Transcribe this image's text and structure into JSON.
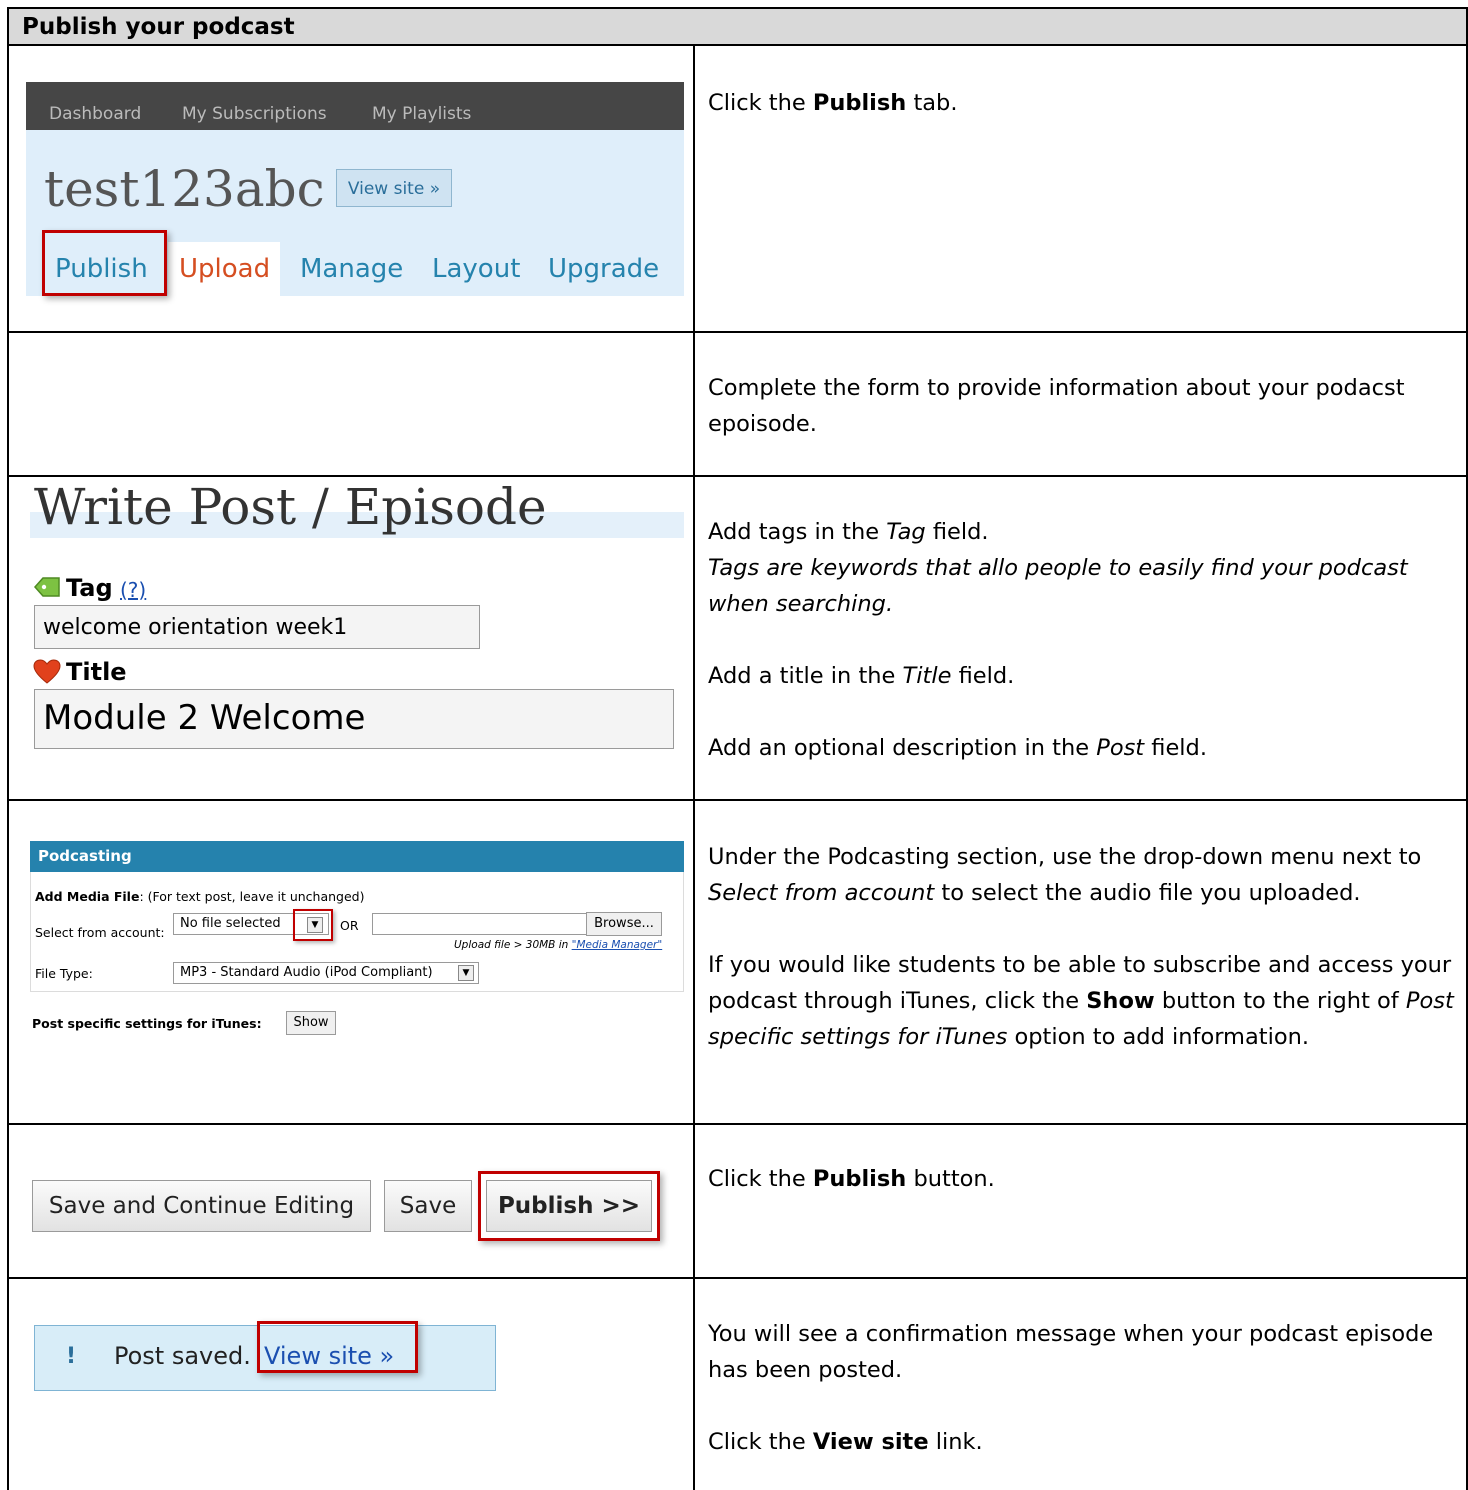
{
  "header": {
    "title": "Publish your podcast"
  },
  "row1": {
    "nav": [
      "Dashboard",
      "My Subscriptions",
      "My Playlists"
    ],
    "blog_name": "test123abc",
    "view_site": "View site »",
    "tabs": [
      "Publish",
      "Upload",
      "Manage",
      "Layout",
      "Upgrade"
    ],
    "instruction": {
      "pre": "Click the ",
      "bold": "Publish",
      "post": " tab."
    }
  },
  "row2": {
    "instruction": "Complete the form to provide information about your podacst epoisode."
  },
  "row3": {
    "heading": "Write Post / Episode",
    "tag_label": "Tag",
    "tag_help": "(?)",
    "tag_value": "welcome orientation week1",
    "title_label": "Title",
    "title_value": "Module 2 Welcome",
    "instr_tags": {
      "pre": "Add tags in the ",
      "em": "Tag",
      "post": " field."
    },
    "instr_tags_note": "Tags are keywords that allo people to easily find your podcast when searching.",
    "instr_title": {
      "pre": "Add a title in the ",
      "em": "Title",
      "post": " field."
    },
    "instr_post": {
      "pre": "Add an optional description in the ",
      "em": "Post",
      "post": " field."
    }
  },
  "row4": {
    "section": "Podcasting",
    "add_media_bold": "Add Media File",
    "add_media_rest": ": (For text post, leave it unchanged)",
    "select_label": "Select from account:",
    "select_value": "No file selected",
    "or": "OR",
    "browse": "Browse...",
    "upload_note_pre": "Upload file > 30MB in ",
    "upload_note_link": "\"Media Manager\"",
    "file_type_label": "File Type:",
    "file_type_value": "MP3 - Standard Audio (iPod Compliant)",
    "itunes_label": "Post specific settings for iTunes",
    "show_button": "Show",
    "instr1_pre": "Under the Podcasting section, use the drop-down menu next to ",
    "instr1_em": "Select from account",
    "instr1_post": " to select the audio file you uploaded.",
    "instr2_pre": "If you would like students to be able to subscribe and access your podcast through iTunes, click the ",
    "instr2_bold": "Show",
    "instr2_mid": " button to the right of ",
    "instr2_em": "Post specific settings for iTunes",
    "instr2_post": " option to add information."
  },
  "row5": {
    "buttons": [
      "Save and Continue Editing",
      "Save",
      "Publish >>"
    ],
    "instruction": {
      "pre": "Click the ",
      "bold": "Publish",
      "post": " button."
    }
  },
  "row6": {
    "icon": "!",
    "message": "Post saved.",
    "link": "View site »",
    "instruction1": "You will see a confirmation message when your podcast episode has been posted.",
    "instruction2": {
      "pre": "Click the ",
      "bold": "View site",
      "post": " link."
    }
  }
}
